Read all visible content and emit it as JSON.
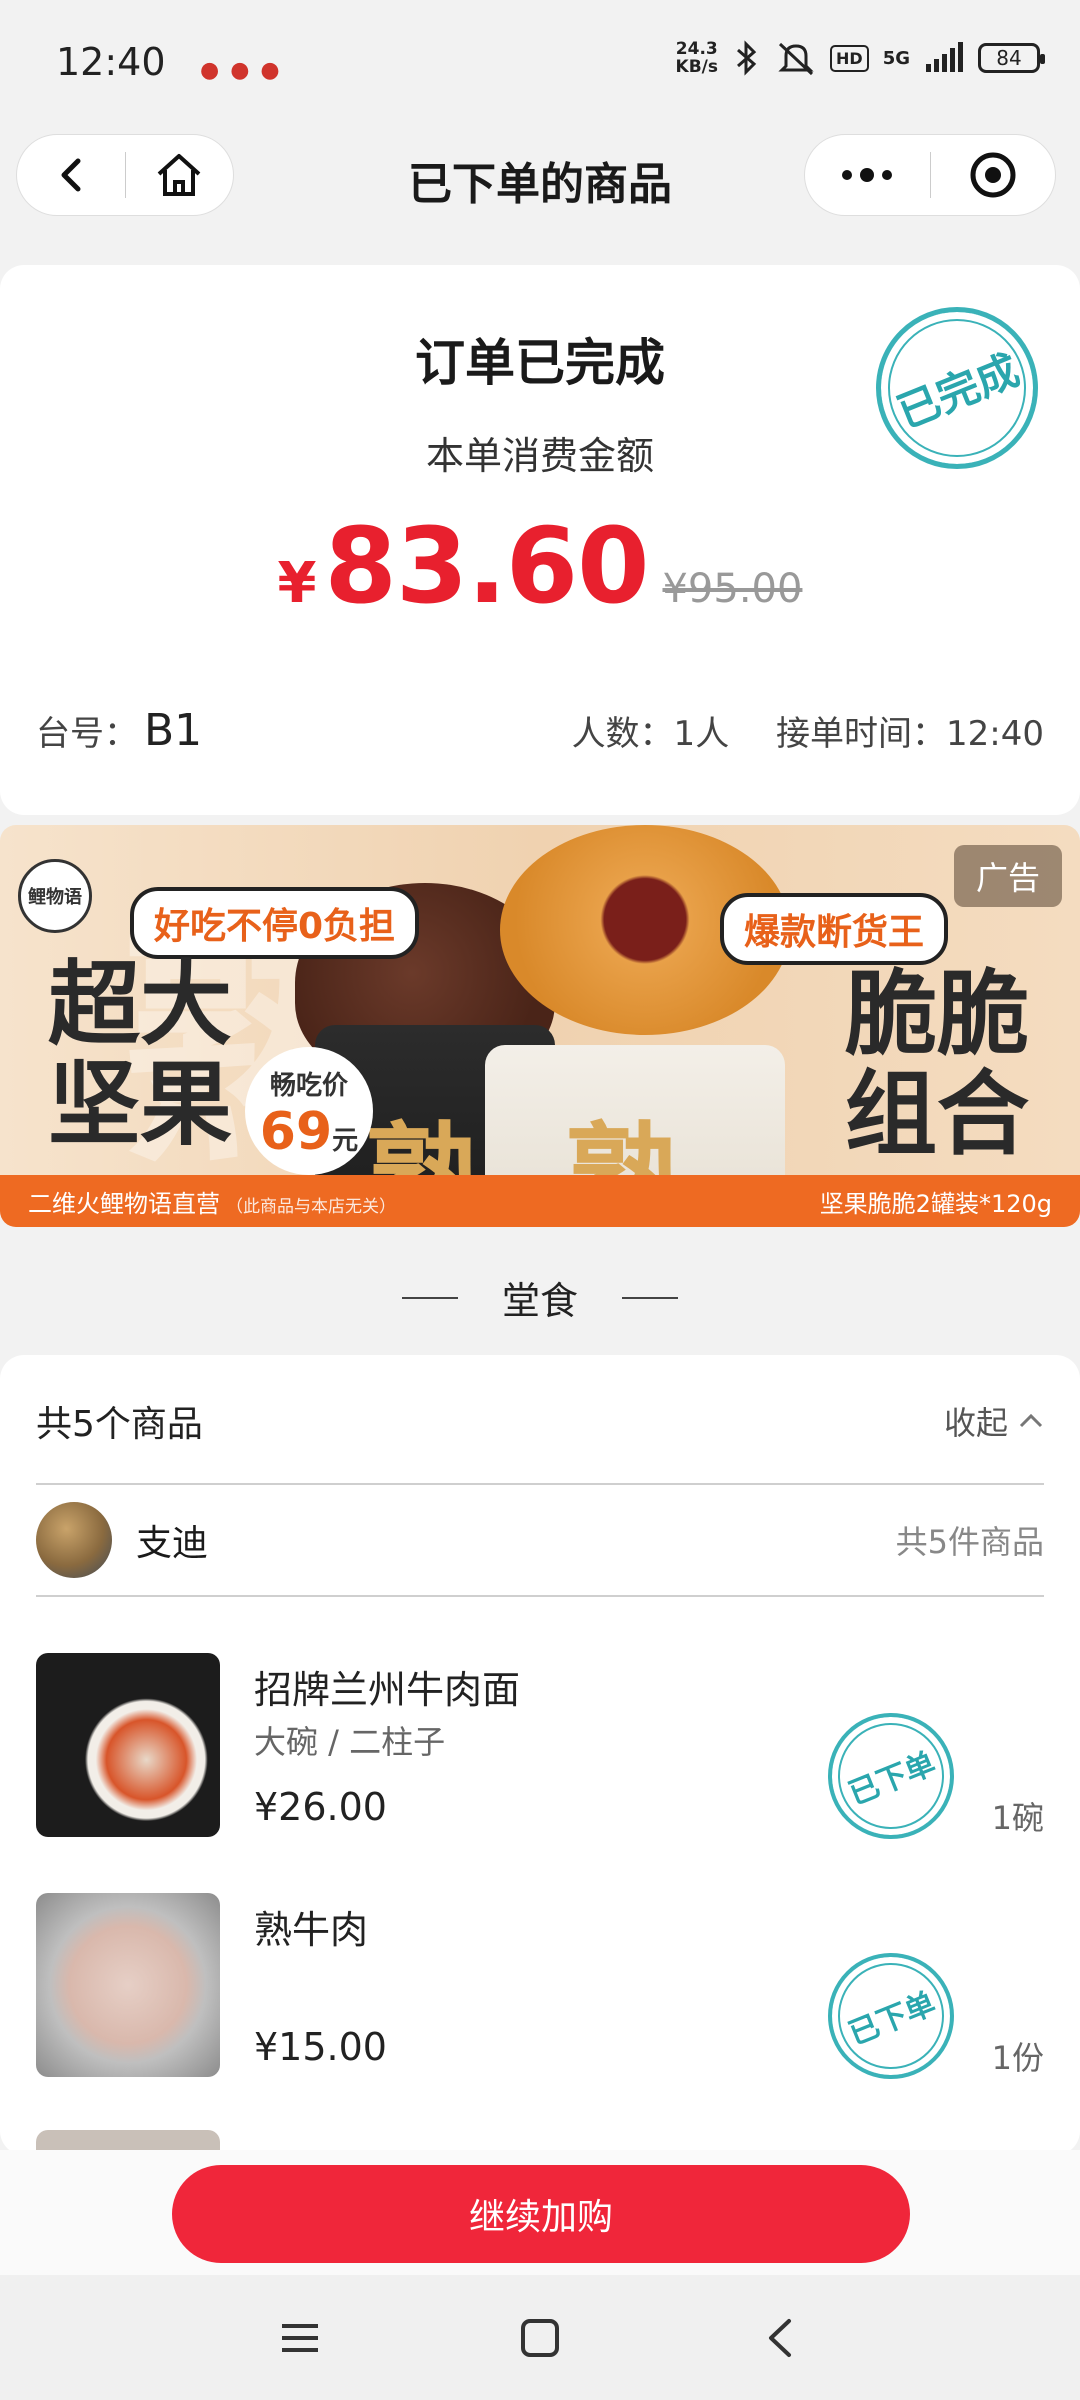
{
  "status_bar": {
    "time": "12:40",
    "net_speed_top": "24.3",
    "net_speed_bottom": "KB/s",
    "hd": "HD",
    "network": "5G",
    "battery": "84"
  },
  "nav": {
    "title": "已下单的商品"
  },
  "order": {
    "status": "订单已完成",
    "subtitle": "本单消费金额",
    "currency": "¥",
    "amount": "83.60",
    "original_amount": "¥95.00",
    "stamp": "已完成",
    "table_label": "台号：",
    "table_no": "B1",
    "people": "人数：1人",
    "time": "接单时间：12:40"
  },
  "ad": {
    "tag": "广告",
    "logo": "鲤物语",
    "bubble_left": "好吃不停0负担",
    "bubble_right": "爆款断货王",
    "headline_left_1": "超大",
    "headline_left_2": "坚果",
    "headline_right_1": "脆脆",
    "headline_right_2": "组合",
    "price_label": "畅吃价",
    "price_value": "69",
    "price_unit": "元",
    "footer_left": "二维火鲤物语直营",
    "footer_note": "（此商品与本店无关）",
    "footer_right": "坚果脆脆2罐装*120g",
    "can_char": "熟"
  },
  "section": {
    "title": "堂食"
  },
  "items": {
    "count_label": "共5个商品",
    "collapse_label": "收起",
    "user_name": "支迪",
    "user_total": "共5件商品",
    "list": [
      {
        "name": "招牌兰州牛肉面",
        "spec": "大碗 / 二柱子",
        "price": "¥26.00",
        "qty": "1碗",
        "stamp": "已下单"
      },
      {
        "name": "熟牛肉",
        "spec": "",
        "price": "¥15.00",
        "qty": "1份",
        "stamp": "已下单"
      }
    ]
  },
  "action": {
    "continue_label": "继续加购"
  },
  "colors": {
    "accent_red": "#f0263a",
    "price_red": "#e8202e",
    "stamp_teal": "#3ab2b8"
  }
}
